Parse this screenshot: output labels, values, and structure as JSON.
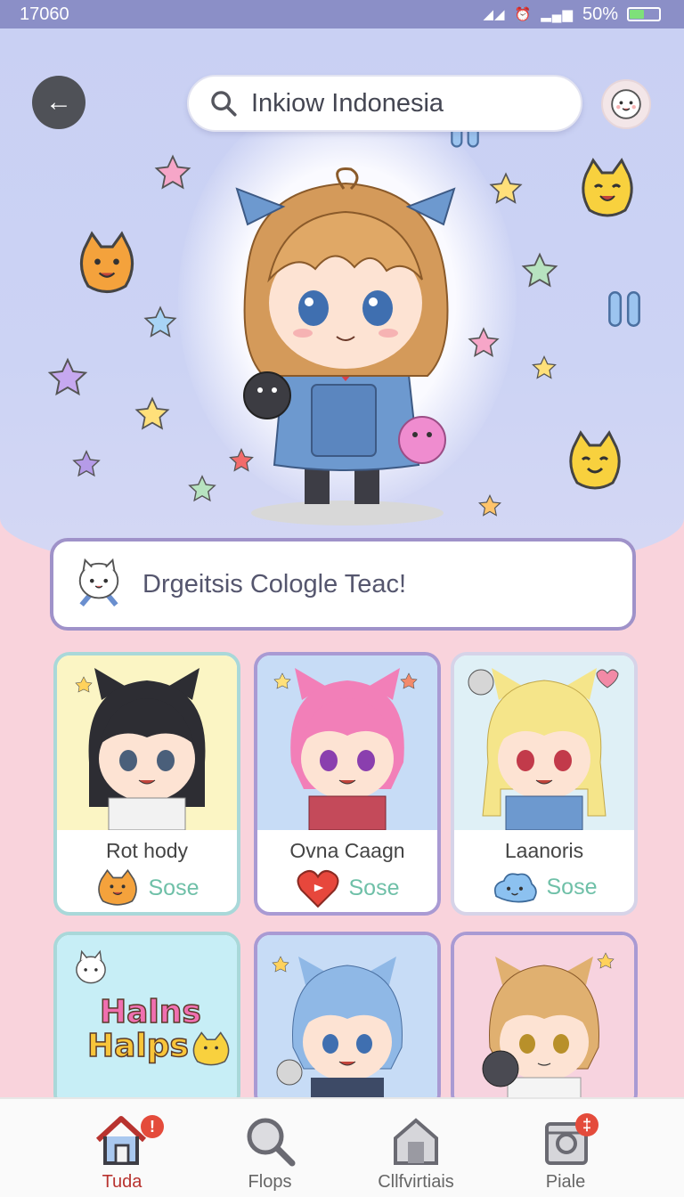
{
  "status_bar": {
    "time": "17060",
    "battery": "50%",
    "battery_level": 0.5
  },
  "header": {
    "back_icon": "arrow-left-icon",
    "search_value": "Inkiow Indonesia",
    "search_icon": "search-icon",
    "profile_icon": "face-icon"
  },
  "banner": {
    "text": "Drgeitsis Cologle Teac!"
  },
  "cards": [
    {
      "name": "Rot hody",
      "status": "Sose",
      "icon": "chick-icon"
    },
    {
      "name": "Ovna Caagn",
      "status": "Sose",
      "icon": "heart-icon"
    },
    {
      "name": "Laanoris",
      "status": "Sose",
      "icon": "blob-icon"
    }
  ],
  "card_art_text": {
    "line1": "Halns",
    "line2": "Halps"
  },
  "tabs": [
    {
      "label": "Tuda",
      "icon": "home-icon",
      "badge": "!"
    },
    {
      "label": "Flops",
      "icon": "magnifier-icon"
    },
    {
      "label": "Cllfvirtiais",
      "icon": "house-icon"
    },
    {
      "label": "Piale",
      "icon": "book-icon",
      "badge": "‡"
    }
  ],
  "colors": {
    "accent": "#b8332f",
    "status_text": "#6fc0a8",
    "banner_border": "#9f92c9",
    "status_bar": "#8b8fc7"
  }
}
